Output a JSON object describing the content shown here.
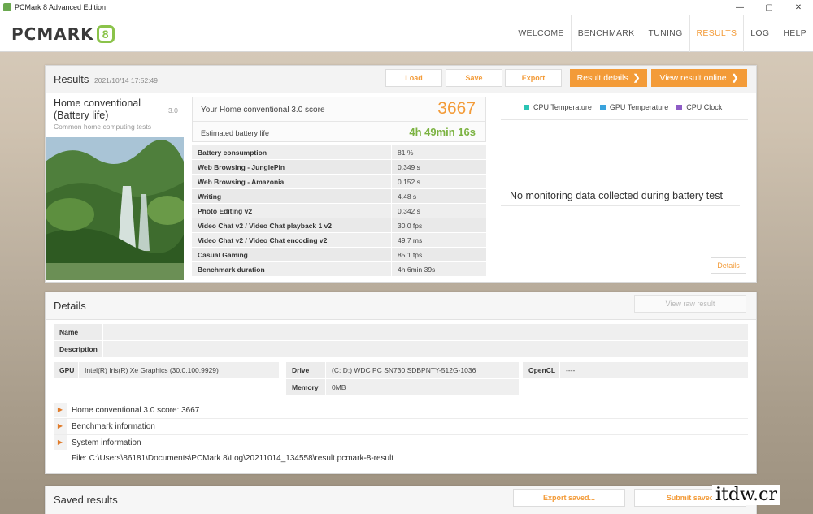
{
  "window": {
    "title": "PCMark 8 Advanced Edition",
    "minimize": "—",
    "maximize": "▢",
    "close": "✕"
  },
  "logo": {
    "text": "PCMARK",
    "mark": "8"
  },
  "nav": [
    {
      "label": "WELCOME"
    },
    {
      "label": "BENCHMARK"
    },
    {
      "label": "TUNING"
    },
    {
      "label": "RESULTS",
      "active": true
    },
    {
      "label": "LOG"
    },
    {
      "label": "HELP"
    }
  ],
  "results": {
    "title": "Results",
    "date": "2021/10/14 17:52:49",
    "buttons": {
      "load": "Load",
      "save": "Save",
      "export": "Export",
      "result_details": "Result details",
      "view_online": "View result online"
    },
    "chevron": "❯",
    "test": {
      "name": "Home conventional (Battery life)",
      "version": "3.0",
      "subtitle": "Common home computing tests"
    },
    "score": {
      "label": "Your Home conventional 3.0 score",
      "value": "3667"
    },
    "battery": {
      "label": "Estimated battery life",
      "value": "4h 49min 16s"
    },
    "metrics": [
      {
        "name": "Battery consumption",
        "value": "81 %"
      },
      {
        "name": "Web Browsing - JunglePin",
        "value": "0.349 s"
      },
      {
        "name": "Web Browsing - Amazonia",
        "value": "0.152 s"
      },
      {
        "name": "Writing",
        "value": "4.48 s"
      },
      {
        "name": "Photo Editing v2",
        "value": "0.342 s"
      },
      {
        "name": "Video Chat v2 / Video Chat playback 1 v2",
        "value": "30.0 fps"
      },
      {
        "name": "Video Chat v2 / Video Chat encoding v2",
        "value": "49.7 ms"
      },
      {
        "name": "Casual Gaming",
        "value": "85.1 fps"
      },
      {
        "name": "Benchmark duration",
        "value": "4h 6min 39s"
      }
    ],
    "legend": [
      {
        "label": "CPU Temperature",
        "color": "#2bc4b4"
      },
      {
        "label": "GPU Temperature",
        "color": "#3aa3dd"
      },
      {
        "label": "CPU Clock",
        "color": "#8e5cc6"
      }
    ],
    "no_data": "No monitoring data collected during battery test",
    "details_button": "Details"
  },
  "details": {
    "title": "Details",
    "view_raw": "View raw result",
    "name_label": "Name",
    "description_label": "Description",
    "gpu_label": "GPU",
    "gpu_value": "Intel(R) Iris(R) Xe Graphics (30.0.100.9929)",
    "drive_label": "Drive",
    "drive_value": "(C: D:) WDC PC SN730 SDBPNTY-512G-1036",
    "memory_label": "Memory",
    "memory_value": "0MB",
    "opencl_label": "OpenCL",
    "opencl_value": "----",
    "expanders": [
      {
        "label": "Home conventional 3.0 score: 3667"
      },
      {
        "label": "Benchmark information"
      },
      {
        "label": "System information"
      }
    ],
    "arrow": "▶",
    "file": "File: C:\\Users\\86181\\Documents\\PCMark 8\\Log\\20211014_134558\\result.pcmark-8-result"
  },
  "saved": {
    "title": "Saved results",
    "export_saved": "Export saved...",
    "submit_saved": "Submit saved"
  },
  "watermark": "itdw.cr"
}
